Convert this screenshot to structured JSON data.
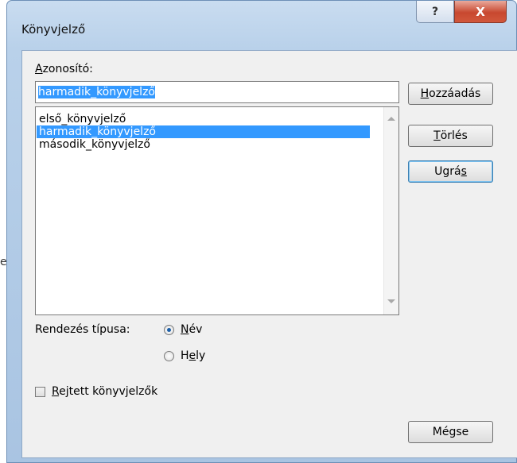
{
  "background": {
    "edge_letter": "e"
  },
  "window": {
    "title": "Könyvjelző",
    "help_glyph": "?",
    "close_glyph": "X"
  },
  "form": {
    "id_label_underlined": "A",
    "id_label_rest": "zonosító:",
    "name_value": "harmadik_könyvjelző",
    "bookmarks": [
      {
        "label": "első_könyvjelző",
        "selected": false
      },
      {
        "label": "harmadik_könyvjelző",
        "selected": true
      },
      {
        "label": "második_könyvjelző",
        "selected": false
      }
    ],
    "sort_label": "Rendezés típusa:",
    "sort_options": [
      {
        "underlined": "N",
        "rest": "év",
        "checked": true
      },
      {
        "pre": "H",
        "underlined": "e",
        "rest": "ly",
        "checked": false
      }
    ],
    "hidden_checkbox": {
      "underlined": "R",
      "rest": "ejtett könyvjelzők",
      "checked": false
    }
  },
  "buttons": {
    "add": {
      "underlined": "H",
      "rest": "ozzáadás"
    },
    "delete": {
      "underlined": "T",
      "rest": "örlés"
    },
    "goto": {
      "pre": "Ugrá",
      "underlined": "s"
    },
    "cancel": "Mégse"
  },
  "colors": {
    "selection": "#3399ff",
    "window_frame": "#b9d1ea",
    "close_button": "#c8482f"
  }
}
